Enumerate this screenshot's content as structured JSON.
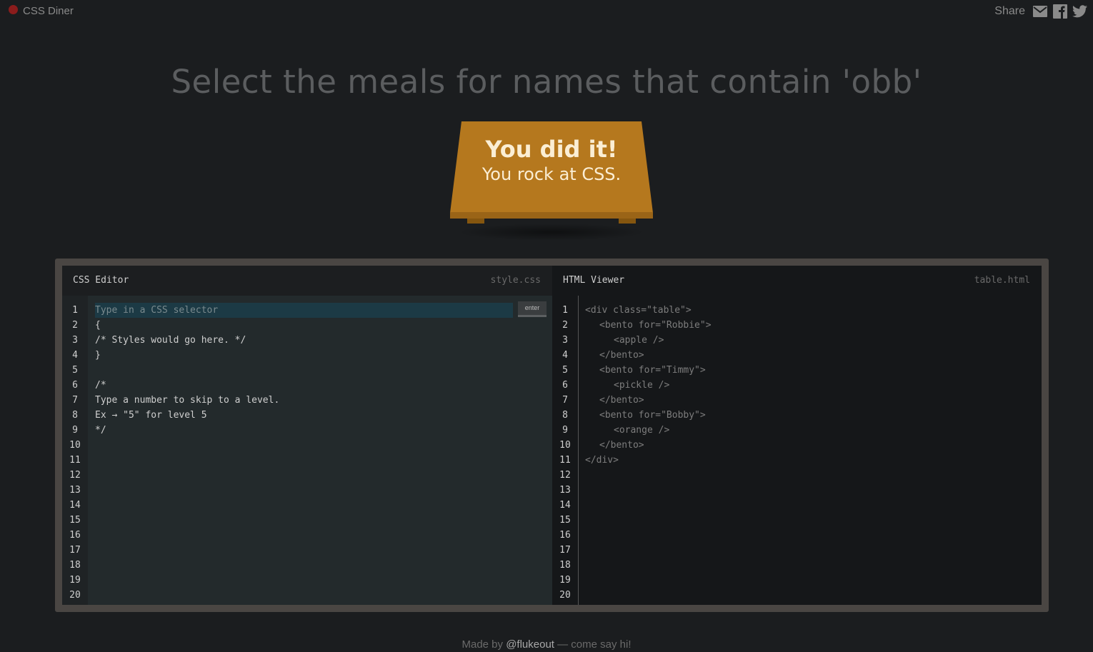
{
  "app": {
    "title": "CSS Diner"
  },
  "share": {
    "label": "Share",
    "icons": [
      "mail-icon",
      "facebook-icon",
      "twitter-icon"
    ]
  },
  "instruction": "Select the meals for names that contain 'obb'",
  "win_message": {
    "line1": "You did it!",
    "line2": "You rock at CSS."
  },
  "css_editor": {
    "title": "CSS Editor",
    "filename": "style.css",
    "input_placeholder": "Type in a CSS selector",
    "input_value": "",
    "enter_label": "enter",
    "line_numbers": [
      "1",
      "2",
      "3",
      "4",
      "5",
      "6",
      "7",
      "8",
      "9",
      "10",
      "11",
      "12",
      "13",
      "14",
      "15",
      "16",
      "17",
      "18",
      "19",
      "20"
    ],
    "lines": [
      "",
      "{",
      "/* Styles would go here. */",
      "}",
      "",
      "/*",
      "Type a number to skip to a level.",
      "Ex → \"5\" for level 5",
      "*/"
    ]
  },
  "html_viewer": {
    "title": "HTML Viewer",
    "filename": "table.html",
    "line_numbers": [
      "1",
      "2",
      "3",
      "4",
      "5",
      "6",
      "7",
      "8",
      "9",
      "10",
      "11",
      "12",
      "13",
      "14",
      "15",
      "16",
      "17",
      "18",
      "19",
      "20"
    ],
    "lines": [
      "<div class=\"table\">",
      "<bento for=\"Robbie\">",
      "<apple />",
      "</bento>",
      "<bento for=\"Timmy\">",
      "<pickle />",
      "</bento>",
      "<bento for=\"Bobby\">",
      "<orange />",
      "</bento>",
      "</div>"
    ]
  },
  "footer": {
    "prefix": "Made by",
    "link": "@flukeout",
    "suffix": "— come say hi!"
  },
  "colors": {
    "background": "#1b1d1f",
    "table": "#b5781e",
    "frame": "#4a4643",
    "input": "#1c3a45"
  }
}
